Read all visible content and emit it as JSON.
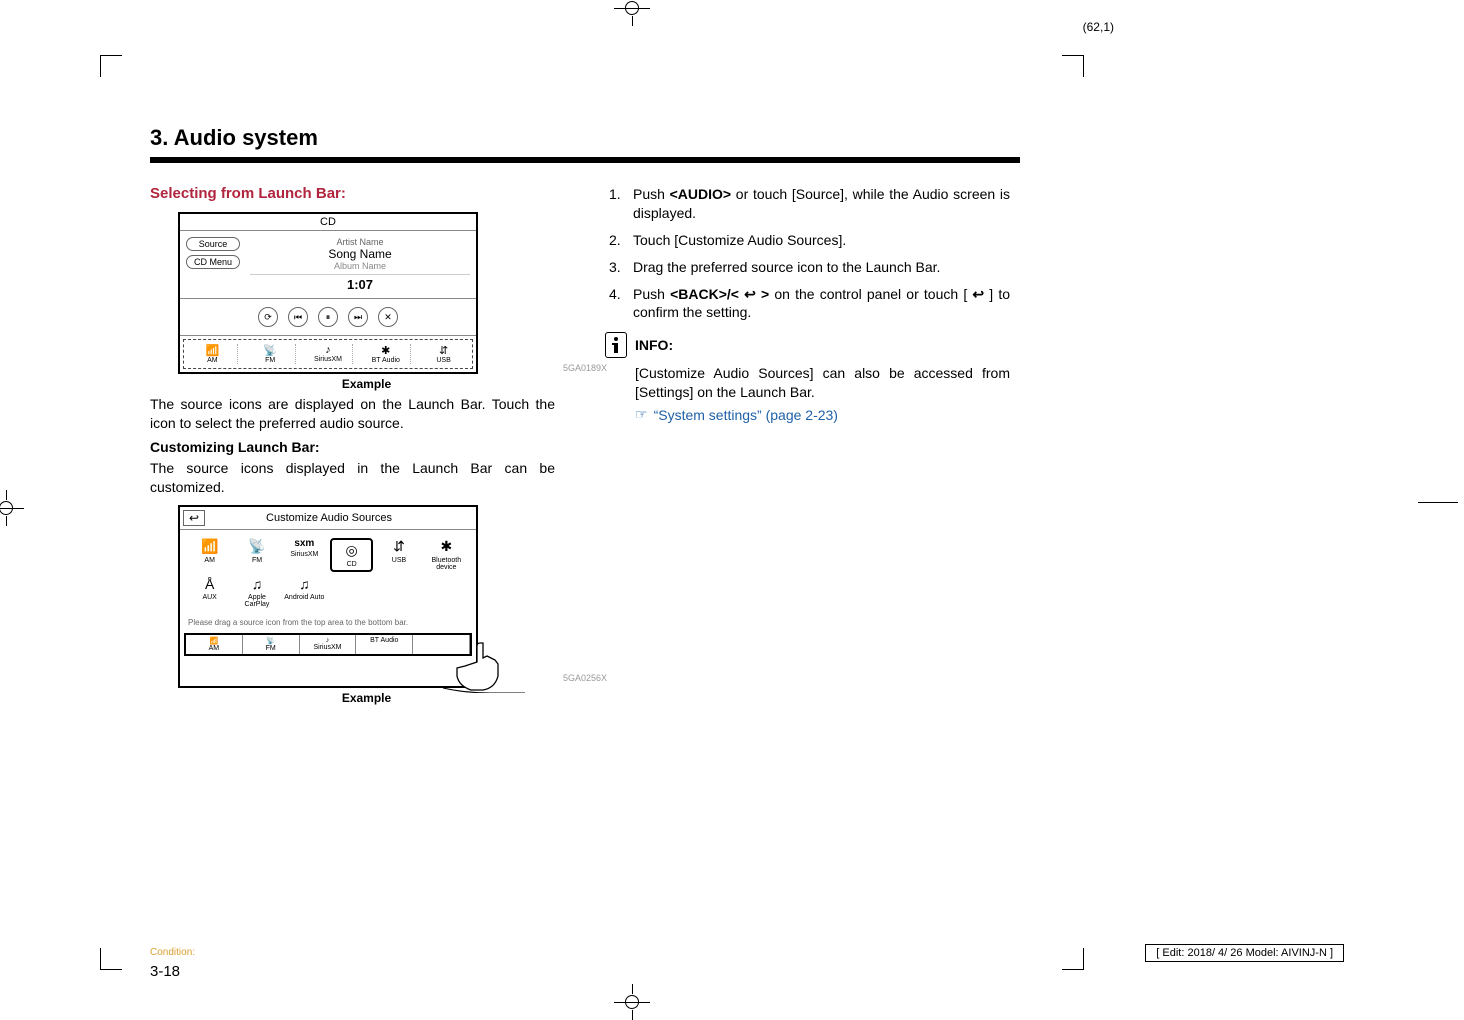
{
  "page_marker": "(62,1)",
  "section_title": "3. Audio system",
  "left_col": {
    "heading_red": "Selecting from Launch Bar:",
    "fig1": {
      "id": "5GA0189X",
      "caption": "Example",
      "screen_title": "CD",
      "source_btn": "Source",
      "cdmenu_btn": "CD Menu",
      "artist": "Artist Name",
      "song": "Song Name",
      "album": "Album Name",
      "time": "1:07",
      "controls": [
        "⟳",
        "⏮",
        "⏸",
        "⏭",
        "✕"
      ],
      "launch": [
        {
          "icon": "📶",
          "label": "AM"
        },
        {
          "icon": "📡",
          "label": "FM"
        },
        {
          "icon": "♪",
          "label": "SiriusXM"
        },
        {
          "icon": "✱",
          "label": "BT Audio"
        },
        {
          "icon": "⇵",
          "label": "USB"
        }
      ]
    },
    "para1": "The source icons are displayed on the Launch Bar. Touch the icon to select the preferred audio source.",
    "heading_bold": "Customizing Launch Bar:",
    "para2": "The source icons displayed in the Launch Bar can be customized.",
    "fig2": {
      "id": "5GA0256X",
      "caption": "Example",
      "back_glyph": "↩",
      "title": "Customize Audio Sources",
      "grid": [
        {
          "icon": "📶",
          "label": "AM"
        },
        {
          "icon": "📡",
          "label": "FM"
        },
        {
          "icon": "sxm",
          "label": "SiriusXM"
        },
        {
          "icon": "◎",
          "label": "CD",
          "sel": true
        },
        {
          "icon": "⇵",
          "label": "USB"
        },
        {
          "icon": "✱",
          "label": "Bluetooth device"
        },
        {
          "icon": "Å",
          "label": "AUX"
        },
        {
          "icon": "♫",
          "label": "Apple CarPlay"
        },
        {
          "icon": "♫",
          "label": "Android Auto"
        }
      ],
      "hint": "Please drag a source icon from the top area to the bottom bar.",
      "bottom": [
        {
          "icon": "📶",
          "label": "AM"
        },
        {
          "icon": "📡",
          "label": "FM"
        },
        {
          "icon": "♪",
          "label": "SiriusXM"
        },
        {
          "icon": "",
          "label": "BT Audio"
        },
        {
          "icon": "",
          "label": ""
        }
      ]
    }
  },
  "right_col": {
    "step1_a": "Push ",
    "step1_b": "<AUDIO>",
    "step1_c": " or touch [Source], while the Audio screen is displayed.",
    "step2": "Touch [Customize Audio Sources].",
    "step3": "Drag the preferred source icon to the Launch Bar.",
    "step4_a": "Push ",
    "step4_b": "<BACK>/< ",
    "step4_c": " >",
    "step4_d": " on the control panel or touch [ ",
    "step4_e": " ] to confirm the setting.",
    "back_glyph": "↩",
    "info_label": "INFO:",
    "info_body": "[Customize Audio Sources] can also be accessed from [Settings] on the Launch Bar.",
    "xref_icon": "☞",
    "xref": "“System settings” (page 2-23)"
  },
  "page_number": "3-18",
  "footer_left": "Condition:",
  "footer_right": "[ Edit: 2018/ 4/ 26   Model: AIVINJ-N ]"
}
